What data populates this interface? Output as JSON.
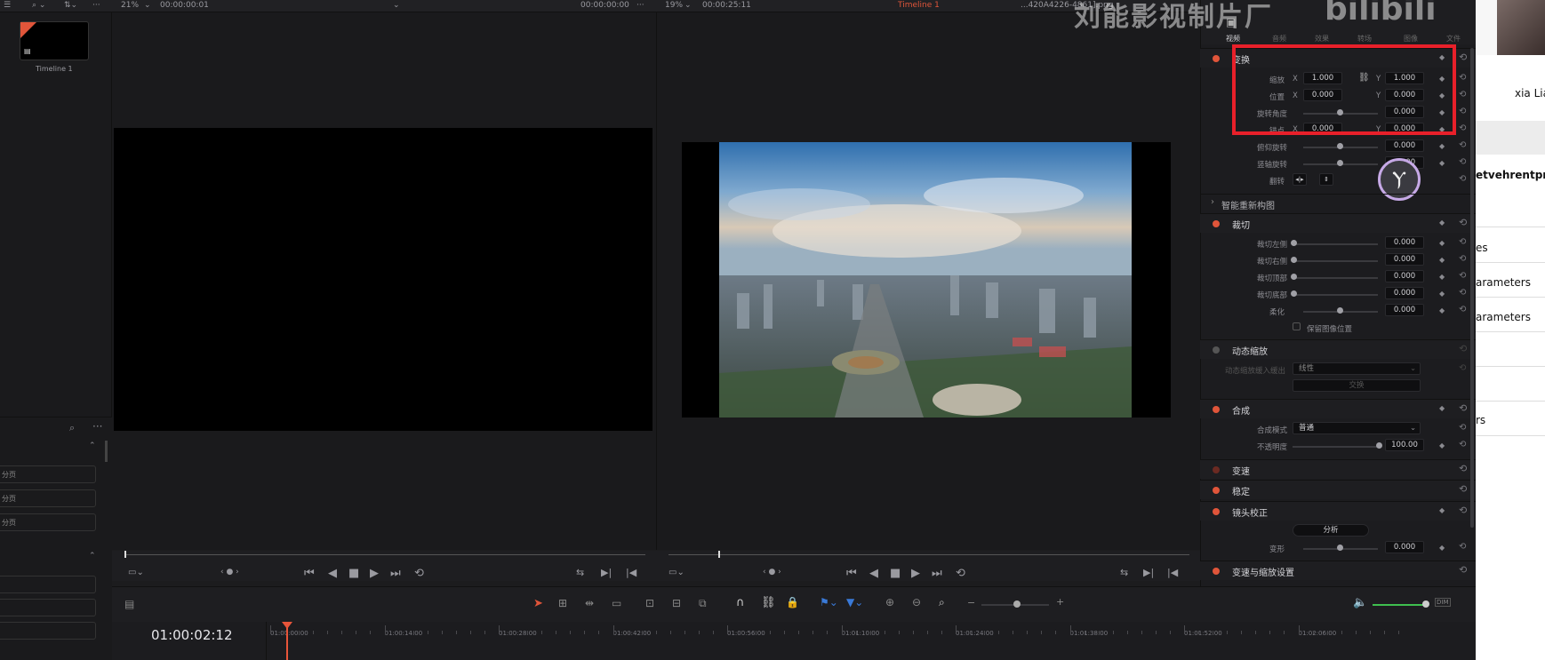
{
  "source_viewer": {
    "zoom": "21%",
    "timecode": "00:00:00:01",
    "timecode_right": "00:00:00:00"
  },
  "timeline_viewer": {
    "zoom": "19%",
    "duration": "00:00:25:11",
    "title_partial": "...420A4226-4861].png",
    "timeline_name": "Timeline 1"
  },
  "media_pool": {
    "clip_name": "Timeline 1",
    "items": [
      "分页",
      "分页",
      "分页"
    ]
  },
  "watermark": {
    "text": "刘能影视制片厂",
    "logo": "bilibili"
  },
  "inspector": {
    "tabs": [
      "视频",
      "音频",
      "效果",
      "转场",
      "图像",
      "文件"
    ],
    "transform": {
      "title": "变换",
      "zoom_label": "缩放",
      "zoom_x": "1.000",
      "zoom_y": "1.000",
      "position_label": "位置",
      "position_x": "0.000",
      "position_y": "0.000",
      "rotation_label": "旋转角度",
      "rotation_value": "0.000",
      "anchor_label": "锚点",
      "anchor_x": "0.000",
      "anchor_y": "0.000",
      "pitch_label": "俯仰旋转",
      "pitch_value": "0.000",
      "yaw_label": "竖轴旋转",
      "yaw_value": "0.000",
      "flip_label": "翻转",
      "x_label": "X",
      "y_label": "Y"
    },
    "smart_reframe": "智能重新构图",
    "cropping": {
      "title": "裁切",
      "crop_left_label": "裁切左侧",
      "crop_left": "0.000",
      "crop_right_label": "裁切右侧",
      "crop_right": "0.000",
      "crop_top_label": "裁切顶部",
      "crop_top": "0.000",
      "crop_bottom_label": "裁切底部",
      "crop_bottom": "0.000",
      "softness_label": "柔化",
      "softness": "0.000",
      "retain_label": "保留图像位置"
    },
    "dynamic_zoom": {
      "title": "动态缩放",
      "ease_label": "动态缩放缓入缓出",
      "ease_value": "线性",
      "swap_label": "交换"
    },
    "composite": {
      "title": "合成",
      "mode_label": "合成模式",
      "mode_value": "普通",
      "opacity_label": "不透明度",
      "opacity_value": "100.00"
    },
    "speed_change": "变速",
    "stabilization": "稳定",
    "lens_correction": {
      "title": "镜头校正",
      "analyze_label": "分析",
      "distortion_label": "变形",
      "distortion_value": "0.000"
    },
    "retime_scaling": "变速与缩放设置"
  },
  "right_overlay": {
    "name_partial": "xia Lia",
    "rows": [
      "etvehrentpro",
      "es",
      "arameters",
      "arameters",
      "rs"
    ]
  },
  "timeline": {
    "timecode": "01:00:02:12",
    "ruler": [
      "01:00:00:00",
      "01:00:14:00",
      "01:00:28:00",
      "01:00:42:00",
      "01:00:56:00",
      "01:01:10:00",
      "01:01:24:00",
      "01:01:38:00",
      "01:01:52:00",
      "01:02:06:00"
    ],
    "audio_dim": "DIM"
  },
  "colors": {
    "accent_red": "#e0553a",
    "highlight_box": "#e8202a",
    "playhead": "#e8553a",
    "audio_green": "#3fbf4f"
  }
}
